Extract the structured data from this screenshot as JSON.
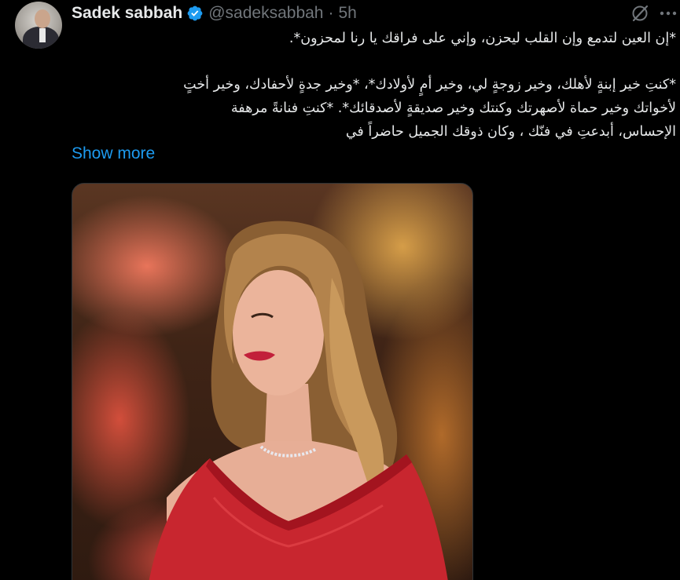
{
  "user": {
    "display_name": "Sadek sabbah",
    "handle": "@sadeksabbah",
    "separator": "·",
    "timestamp": "5h",
    "verified": true
  },
  "tweet": {
    "lines": [
      "*إن العين لتدمع وإن القلب ليحزن، وإني على فراقك يا رنا لمحزون*.",
      "",
      "*كنتِ خير إبنةٍ لأهلك، وخير زوجةٍ لي، وخير أمٍ لأولادك*، *وخير جدةٍ لأحفادك، وخير أختٍ",
      "لأخواتك وخير حماة لأصهرتك وكنتك وخير صديقةٍ لأصدقائك*. *كنتِ فنانةً مرهفة",
      "الإحساس، أبدعتِ في فنّك ، وكان ذوقك الجميل حاضراً في"
    ],
    "show_more_label": "Show more"
  },
  "icons": {
    "verified": "verified-badge-icon",
    "grok": "grok-icon",
    "more": "more-options-icon"
  },
  "colors": {
    "background": "#000000",
    "text": "#e7e9ea",
    "secondary": "#71767b",
    "accent": "#1d9bf0"
  }
}
